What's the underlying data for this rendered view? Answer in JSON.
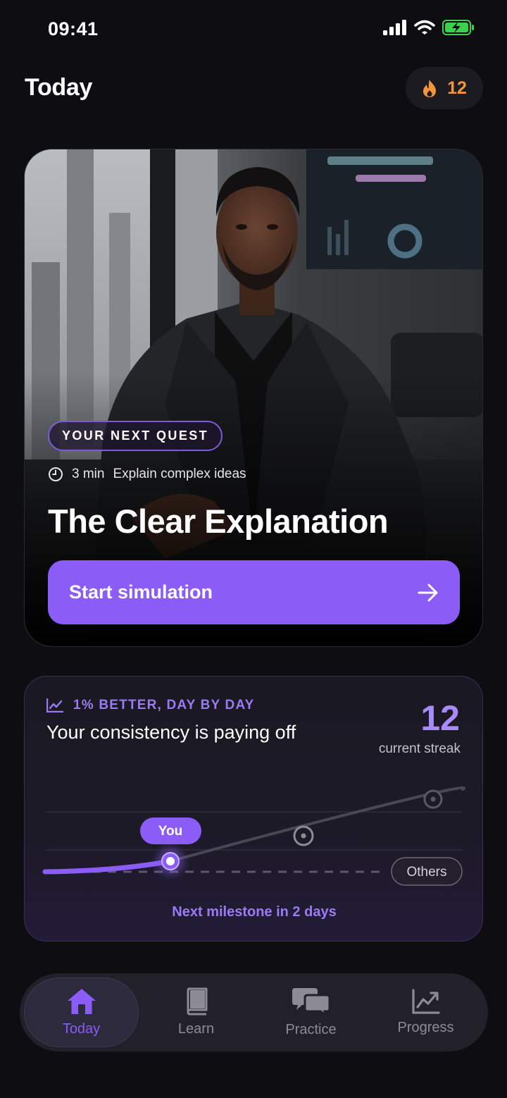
{
  "status_bar": {
    "time": "09:41"
  },
  "header": {
    "title": "Today",
    "streak_count": "12"
  },
  "hero": {
    "badge": "YOUR NEXT QUEST",
    "duration": "3 min",
    "topic": "Explain complex ideas",
    "title": "The Clear Explanation",
    "cta_label": "Start simulation"
  },
  "progress": {
    "eyebrow": "1% BETTER, DAY BY DAY",
    "title": "Your consistency is paying off",
    "streak_value": "12",
    "streak_label": "current streak",
    "you_label": "You",
    "others_label": "Others",
    "milestone": "Next milestone in 2 days"
  },
  "nav": {
    "items": [
      {
        "label": "Today",
        "icon": "home-icon",
        "active": true
      },
      {
        "label": "Learn",
        "icon": "book-icon",
        "active": false
      },
      {
        "label": "Practice",
        "icon": "chat-bubbles-icon",
        "active": false
      },
      {
        "label": "Progress",
        "icon": "trend-chart-icon",
        "active": false
      }
    ]
  },
  "colors": {
    "accent": "#8b5cf6",
    "streak": "#f2963a",
    "background": "#0e0d12"
  }
}
